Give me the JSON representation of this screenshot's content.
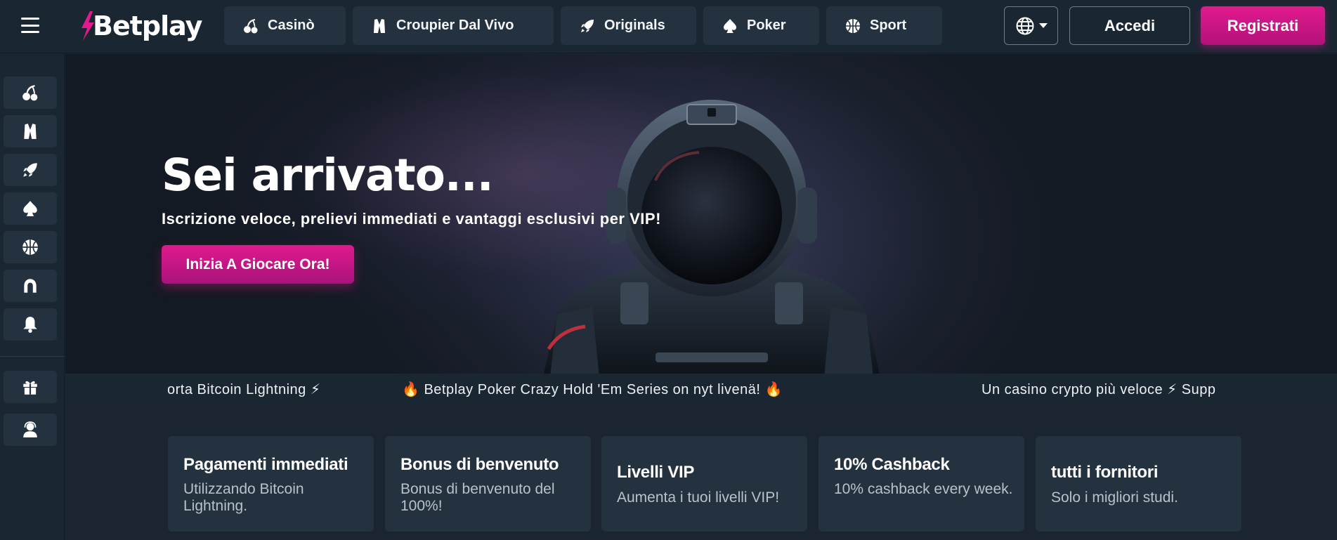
{
  "header": {
    "logo_text": "Betplay",
    "nav": [
      {
        "label": "Casinò",
        "icon": "cherries-icon"
      },
      {
        "label": "Croupier Dal Vivo",
        "icon": "dealer-vest-icon"
      },
      {
        "label": "Originals",
        "icon": "rocket-icon"
      },
      {
        "label": "Poker",
        "icon": "spade-icon"
      },
      {
        "label": "Sport",
        "icon": "basketball-icon"
      }
    ],
    "language_icon": "globe-icon",
    "login_label": "Accedi",
    "register_label": "Registrati"
  },
  "sidebar": {
    "items": [
      {
        "icon": "cherries-icon"
      },
      {
        "icon": "dealer-vest-icon"
      },
      {
        "icon": "rocket-icon"
      },
      {
        "icon": "spade-icon"
      },
      {
        "icon": "basketball-icon"
      },
      {
        "icon": "horseshoe-icon"
      },
      {
        "icon": "bell-icon"
      },
      {
        "icon": "gift-icon"
      },
      {
        "icon": "support-agent-icon"
      }
    ]
  },
  "hero": {
    "title": "Sei arrivato...",
    "subtitle": "Iscrizione veloce, prelievi immediati e vantaggi esclusivi per VIP!",
    "cta_label": "Inizia A Giocare Ora!"
  },
  "ticker": {
    "items": [
      "orta Bitcoin Lightning ⚡",
      "🔥 Betplay Poker Crazy Hold 'Em Series on nyt livenä! 🔥",
      "Un casino crypto più veloce ⚡ Supp"
    ]
  },
  "features": [
    {
      "title": "Pagamenti immediati",
      "desc": "Utilizzando Bitcoin Lightning."
    },
    {
      "title": "Bonus di benvenuto",
      "desc": "Bonus di benvenuto del 100%!"
    },
    {
      "title": "Livelli VIP",
      "desc": "Aumenta i tuoi livelli VIP!"
    },
    {
      "title": "10% Cashback",
      "desc": "10% cashback every week."
    },
    {
      "title": "tutti i fornitori",
      "desc": "Solo i migliori studi."
    }
  ],
  "colors": {
    "accent": "#e21a8e",
    "background": "#1b2531",
    "card": "#243240"
  }
}
